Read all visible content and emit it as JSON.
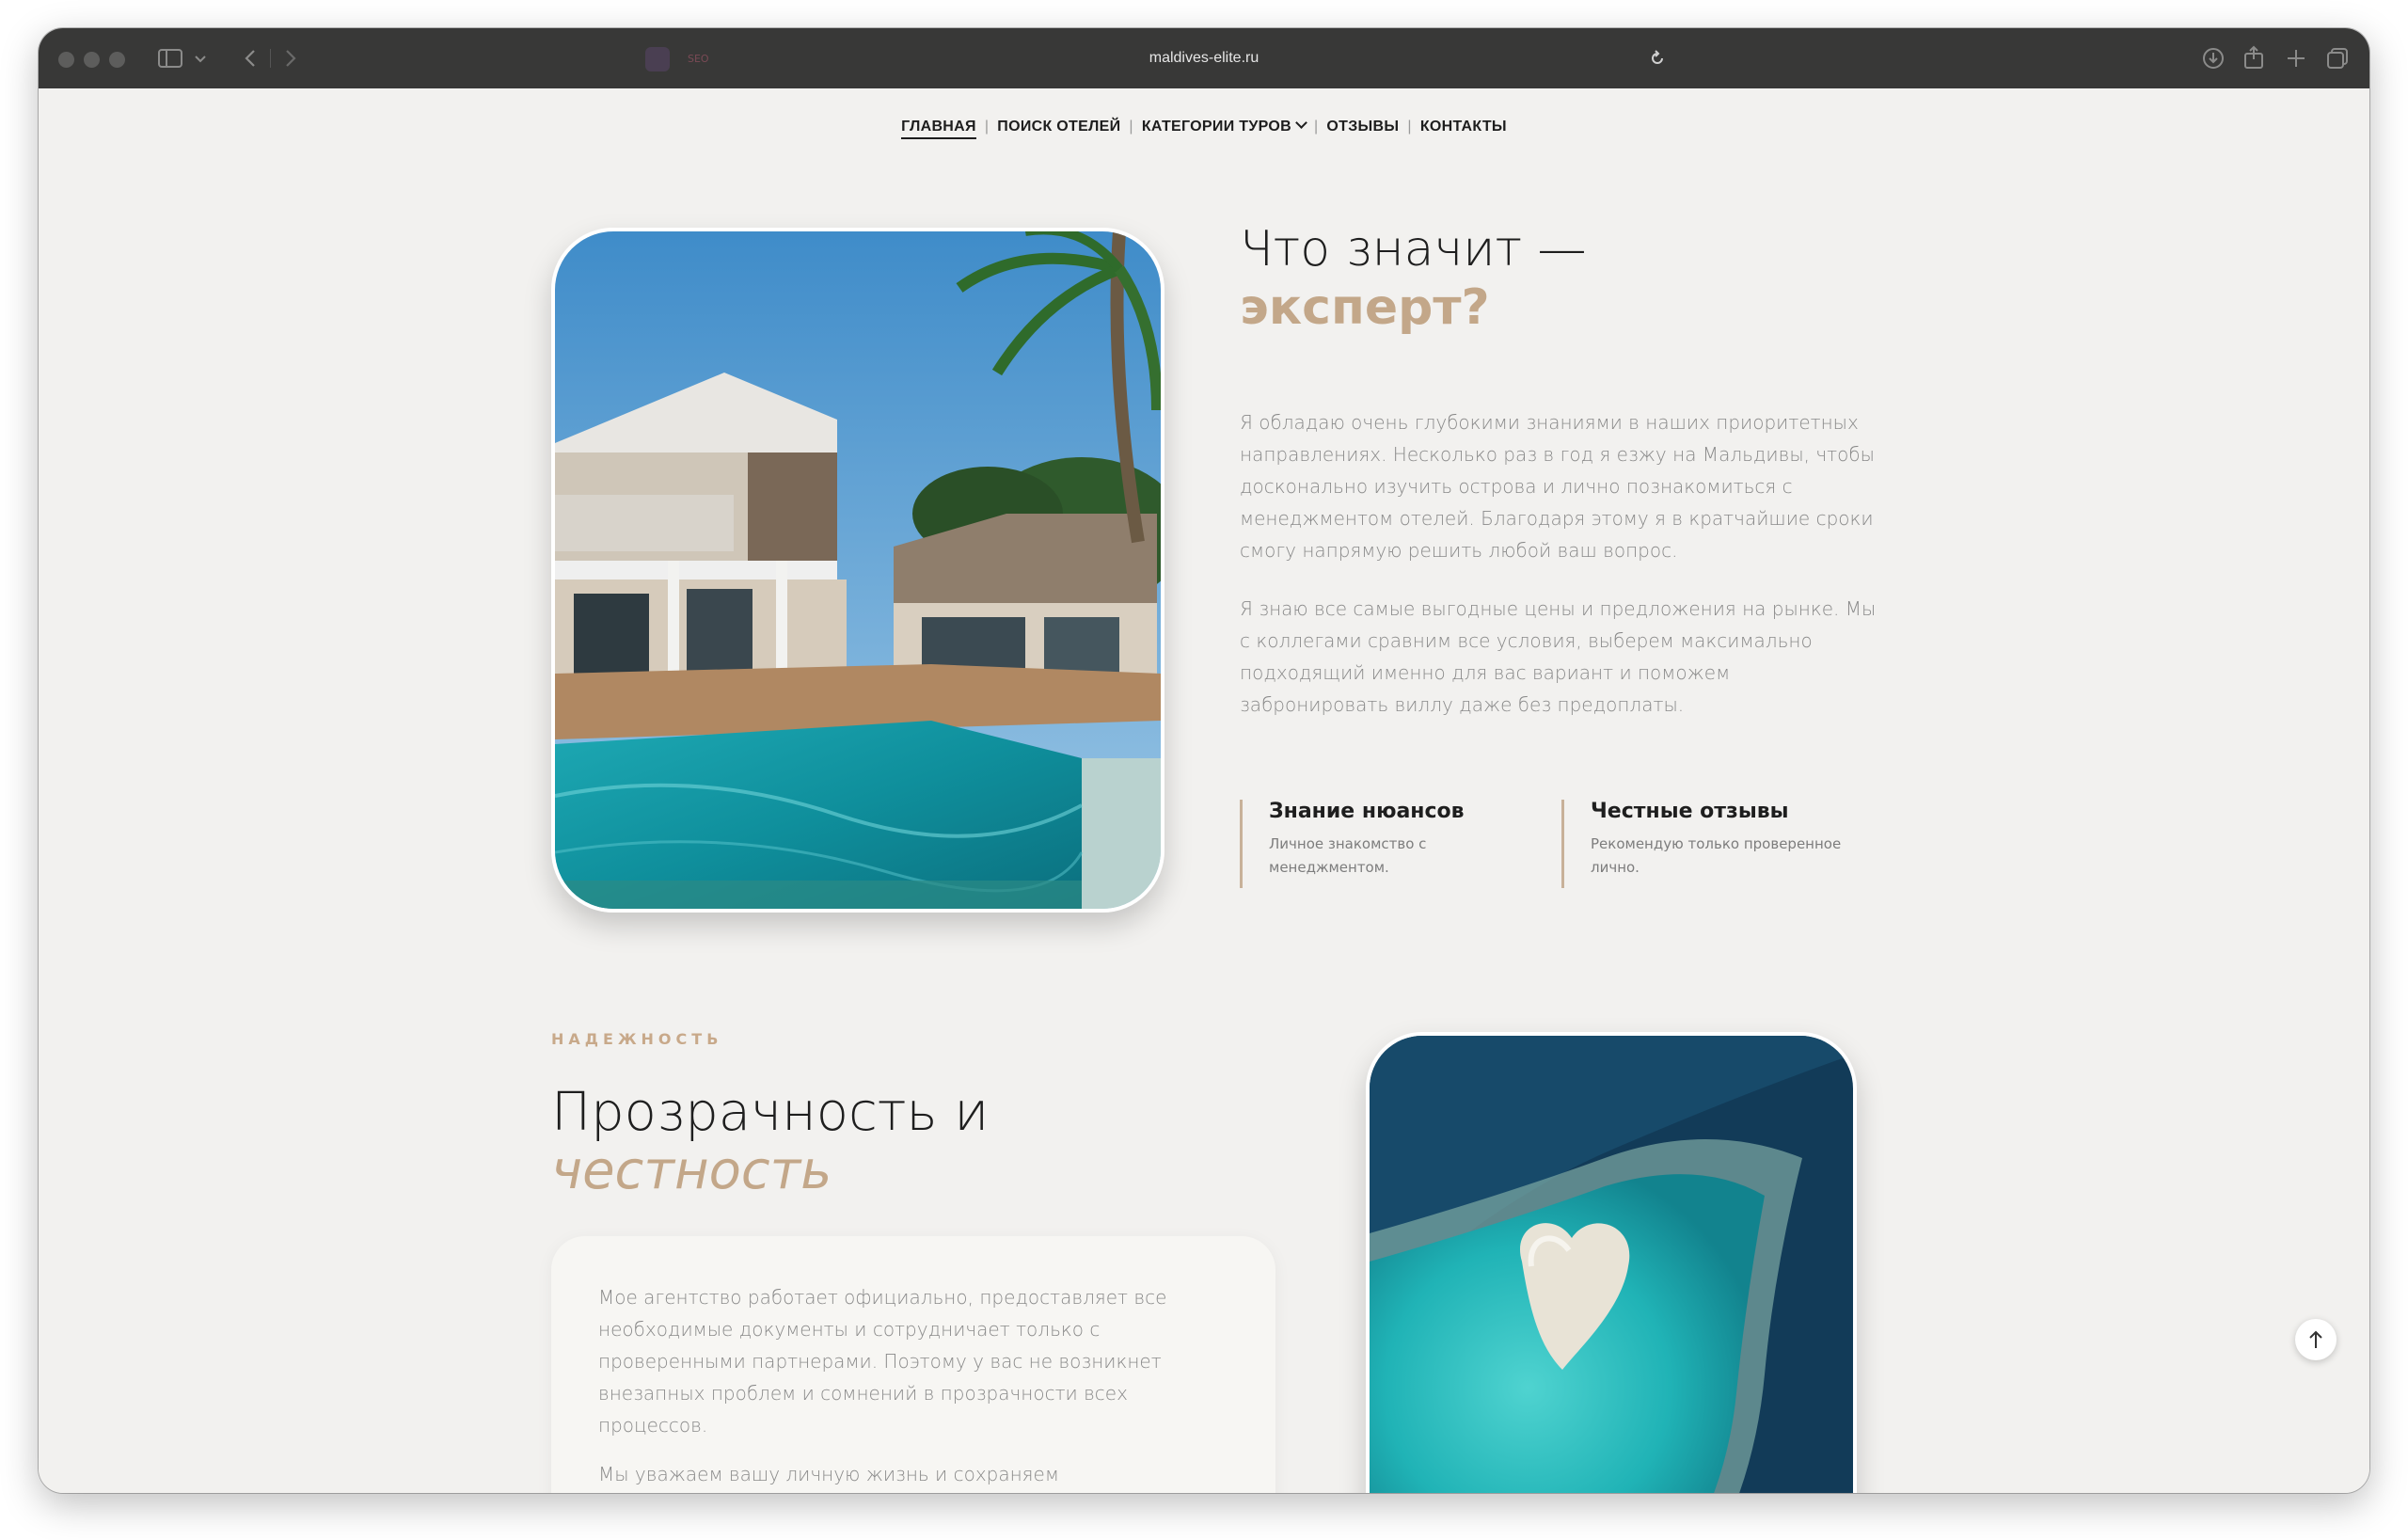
{
  "browser": {
    "url": "maldives-elite.ru",
    "extension_badge": "SEO",
    "icons": [
      "sidebar-icon",
      "chevron-down-icon",
      "back-icon",
      "forward-icon",
      "reload-icon",
      "download-icon",
      "share-icon",
      "new-tab-icon",
      "tabs-overview-icon"
    ]
  },
  "nav": {
    "items": [
      {
        "label": "ГЛАВНАЯ",
        "active": true
      },
      {
        "label": "ПОИСК ОТЕЛЕЙ"
      },
      {
        "label": "КАТЕГОРИИ ТУРОВ",
        "dropdown": true
      },
      {
        "label": "ОТЗЫВЫ"
      },
      {
        "label": "КОНТАКТЫ"
      }
    ],
    "separator": "|"
  },
  "expert": {
    "title_line1": "Что значит —",
    "title_line2": "эксперт?",
    "paragraph1": [
      "Я обладаю очень глубокими знаниями в наших приоритетных",
      "направлениях. Несколько раз в год я езжу на Мальдивы, чтобы",
      "досконально изучить острова и лично познакомиться с",
      "менеджментом отелей. Благодаря этому я в кратчайшие сроки",
      "смогу напрямую решить любой ваш вопрос."
    ],
    "paragraph2": [
      "Я знаю все самые выгодные цены и предложения на рынке. Мы",
      "с коллегами сравним все условия, выберем максимально",
      "подходящий именно для вас вариант и поможем",
      "забронировать виллу даже без предоплаты."
    ],
    "features": [
      {
        "title": "Знание нюансов",
        "desc": [
          "Личное знакомство с",
          "менеджментом."
        ]
      },
      {
        "title": "Честные отзывы",
        "desc": [
          "Рекомендую только проверенное",
          "лично."
        ]
      }
    ]
  },
  "reliability": {
    "eyebrow": "НАДЕЖНОСТЬ",
    "title_line1": "Прозрачность и",
    "title_line2": "честность",
    "card_text": [
      "Мое агентство работает официально, предоставляет все",
      "необходимые документы и сотрудничает только с",
      "проверенными партнерами. Поэтому у вас не возникнет",
      "внезапных проблем и сомнений в прозрачности всех",
      "процессов."
    ],
    "card_text2": "Мы уважаем вашу личную жизнь и сохраняем"
  },
  "colors": {
    "accent": "#c3a789",
    "background": "#f2f1ef",
    "text": "#1e1e1e"
  }
}
